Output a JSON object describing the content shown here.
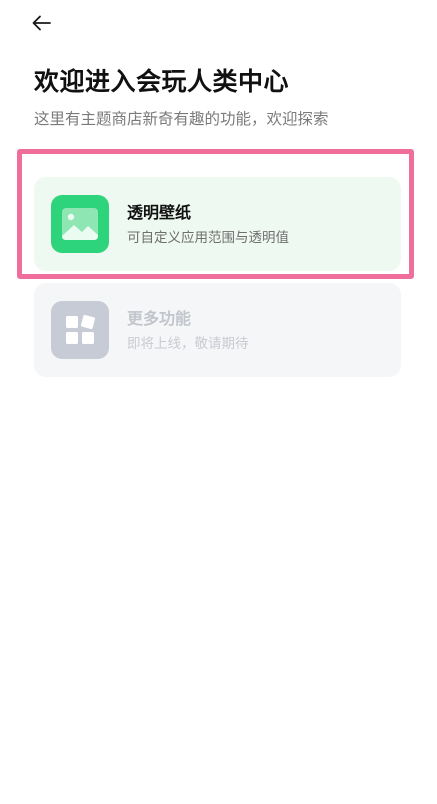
{
  "header": {
    "back_icon": "back-arrow-icon",
    "title": "欢迎进入会玩人类中心",
    "subtitle": "这里有主题商店新奇有趣的功能，欢迎探索"
  },
  "cards": [
    {
      "title": "透明壁纸",
      "description": "可自定义应用范围与透明值",
      "icon": "image-icon",
      "icon_color": "#2ED47C",
      "background": "#EDF9F1",
      "enabled": true,
      "highlighted": true
    },
    {
      "title": "更多功能",
      "description": "即将上线，敬请期待",
      "icon": "widgets-icon",
      "icon_color": "#C6CBD6",
      "background": "#F5F6F8",
      "enabled": false
    }
  ],
  "highlight_color": "#EF6E9B"
}
